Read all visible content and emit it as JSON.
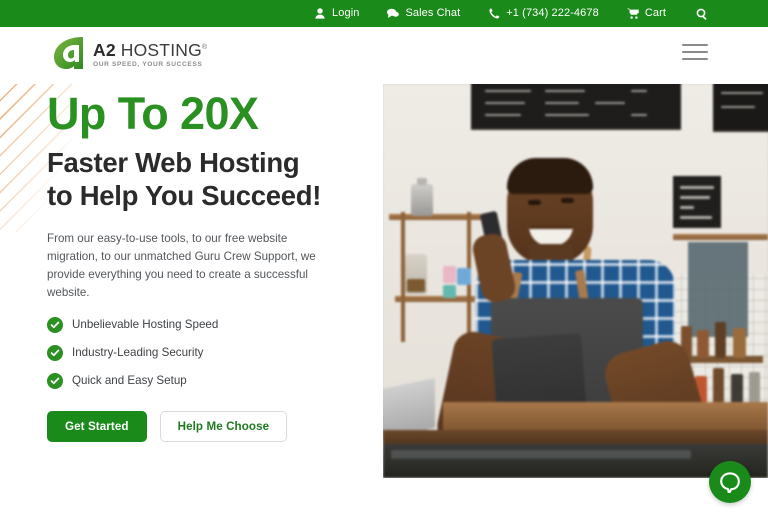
{
  "brand": {
    "name_bold": "A2",
    "name_light": "HOSTING",
    "registered_mark": "®",
    "tagline": "OUR SPEED, YOUR SUCCESS",
    "green": "#1a8a1a",
    "accent_green": "#2a9021",
    "stripe_orange": "#e6a76a"
  },
  "topbar": {
    "items": [
      {
        "label": "Login",
        "icon": "user-icon"
      },
      {
        "label": "Sales Chat",
        "icon": "chat-bubble-icon"
      },
      {
        "label": "+1 (734) 222-4678",
        "icon": "phone-icon"
      },
      {
        "label": "Cart",
        "icon": "shopping-cart-icon"
      }
    ],
    "search_icon": "search-icon"
  },
  "header": {
    "menu_icon": "hamburger-menu-icon"
  },
  "hero": {
    "headline_accent": "Up To 20X",
    "headline_line1": "Faster Web Hosting",
    "headline_line2": "to Help You Succeed!",
    "paragraph": "From our easy-to-use tools, to our free website migration, to our unmatched Guru Crew Support, we provide everything you need to create a successful website.",
    "features": [
      "Unbelievable Hosting Speed",
      "Industry-Leading Security",
      "Quick and Easy Setup"
    ],
    "primary_cta": "Get Started",
    "secondary_cta": "Help Me Choose",
    "image_alt": "Smiling cafe owner on the phone holding a tablet behind the counter"
  },
  "chat": {
    "icon": "chat-launcher-icon"
  }
}
